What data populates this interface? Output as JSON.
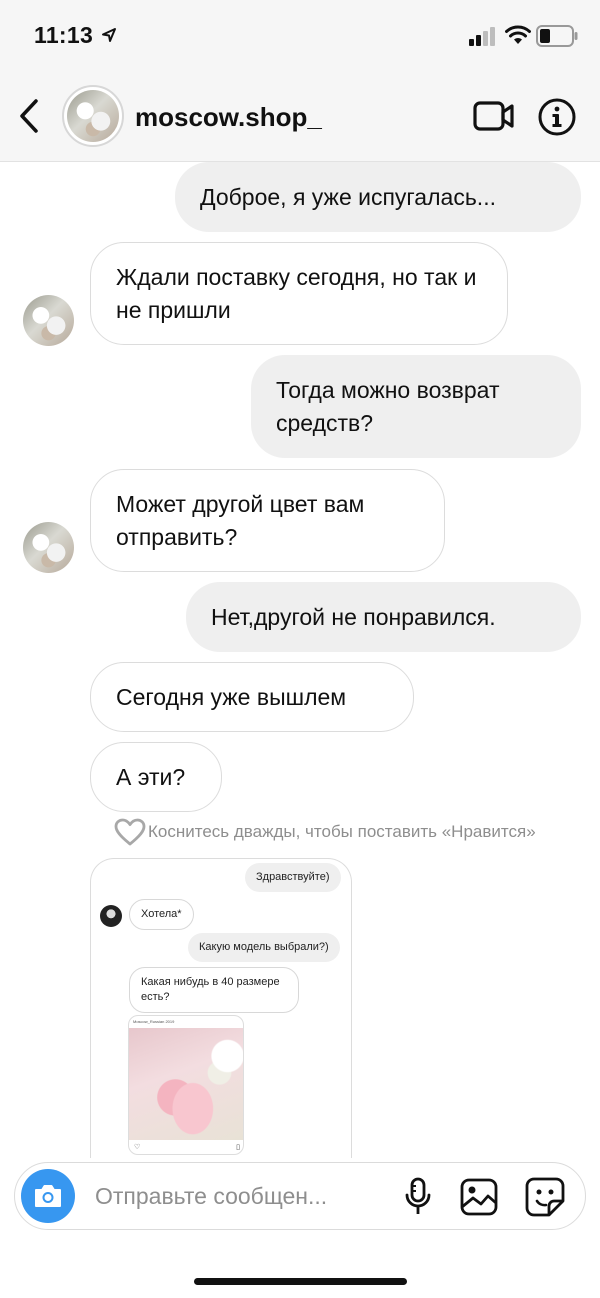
{
  "status_bar": {
    "time": "11:13",
    "icons": [
      "location-arrow-icon",
      "signal-icon",
      "wifi-icon",
      "battery-icon"
    ]
  },
  "header": {
    "title": "moscow.shop_",
    "icons": [
      "back-chevron-icon",
      "video-call-icon",
      "info-icon"
    ]
  },
  "messages": [
    {
      "side": "sent",
      "text": "Доброе, я уже испугалась..."
    },
    {
      "side": "received",
      "text": "Ждали поставку сегодня, но так и не пришли"
    },
    {
      "side": "sent",
      "text": "Тогда можно возврат средств?"
    },
    {
      "side": "received",
      "text": "Может другой цвет вам отправить?"
    },
    {
      "side": "sent",
      "text": "Нет,другой не понравился."
    },
    {
      "side": "received",
      "text": "Сегодня уже вышлем"
    },
    {
      "side": "received",
      "text": "А эти?"
    }
  ],
  "like_hint": "Коснитесь дважды, чтобы поставить «Нравится»",
  "shared_screenshot": {
    "messages": [
      {
        "side": "sent",
        "text": "Здравствуйте)"
      },
      {
        "side": "received",
        "text": "Хотела*"
      },
      {
        "side": "sent",
        "text": "Какую модель выбрали?)"
      },
      {
        "side": "received",
        "text": "Какая нибудь в 40 размере есть?"
      }
    ],
    "post_caption": "Moscow_Russian 2019"
  },
  "composer": {
    "placeholder": "Отправьте сообщен...",
    "icons": [
      "camera-icon",
      "microphone-icon",
      "gallery-icon",
      "sticker-icon"
    ]
  },
  "colors": {
    "accent_blue": "#3797f0",
    "sent_bubble": "#efefef",
    "received_border": "#dcdcdc",
    "muted_text": "#8e8e8e"
  }
}
